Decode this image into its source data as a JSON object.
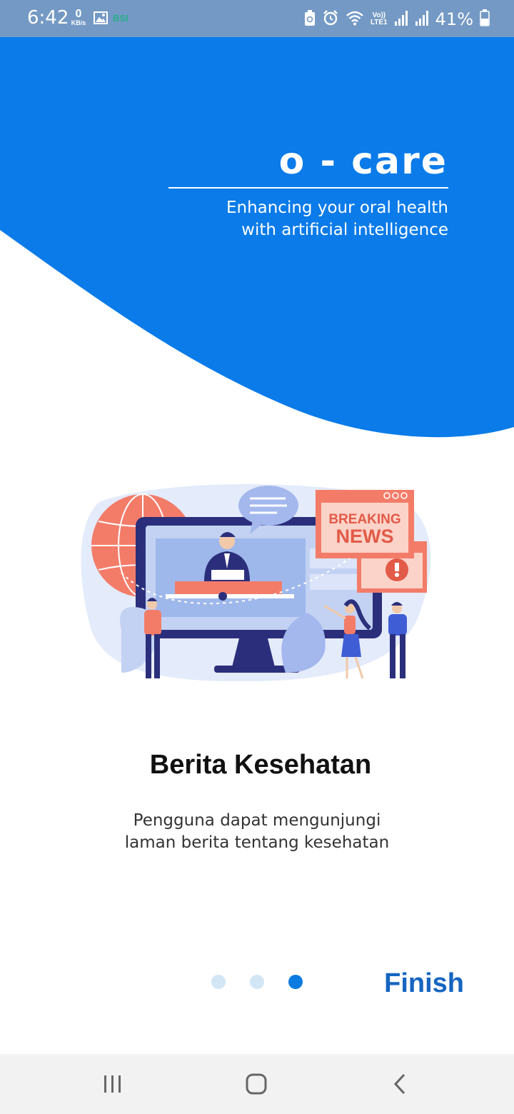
{
  "status_bar": {
    "time": "6:42",
    "net_speed_value": "0",
    "net_speed_unit": "KB/s",
    "carrier_badge": "BSI",
    "volte_line1": "Vo))",
    "volte_line2": "LTE1",
    "battery_percent": "41%"
  },
  "hero": {
    "app_name": "o - care",
    "tagline_line1": "Enhancing your oral health",
    "tagline_line2": "with artificial intelligence",
    "background_color": "#0a7be9"
  },
  "illustration": {
    "banner_line1": "BREAKING",
    "banner_line2": "NEWS"
  },
  "onboarding": {
    "title": "Berita Kesehatan",
    "description_line1": "Pengguna dapat mengunjungi",
    "description_line2": "laman berita tentang kesehatan",
    "page_count": 3,
    "active_page": 3,
    "finish_label": "Finish"
  },
  "colors": {
    "accent": "#0a7be1",
    "finish": "#1565c0",
    "dot_inactive": "#d2e6f6"
  }
}
